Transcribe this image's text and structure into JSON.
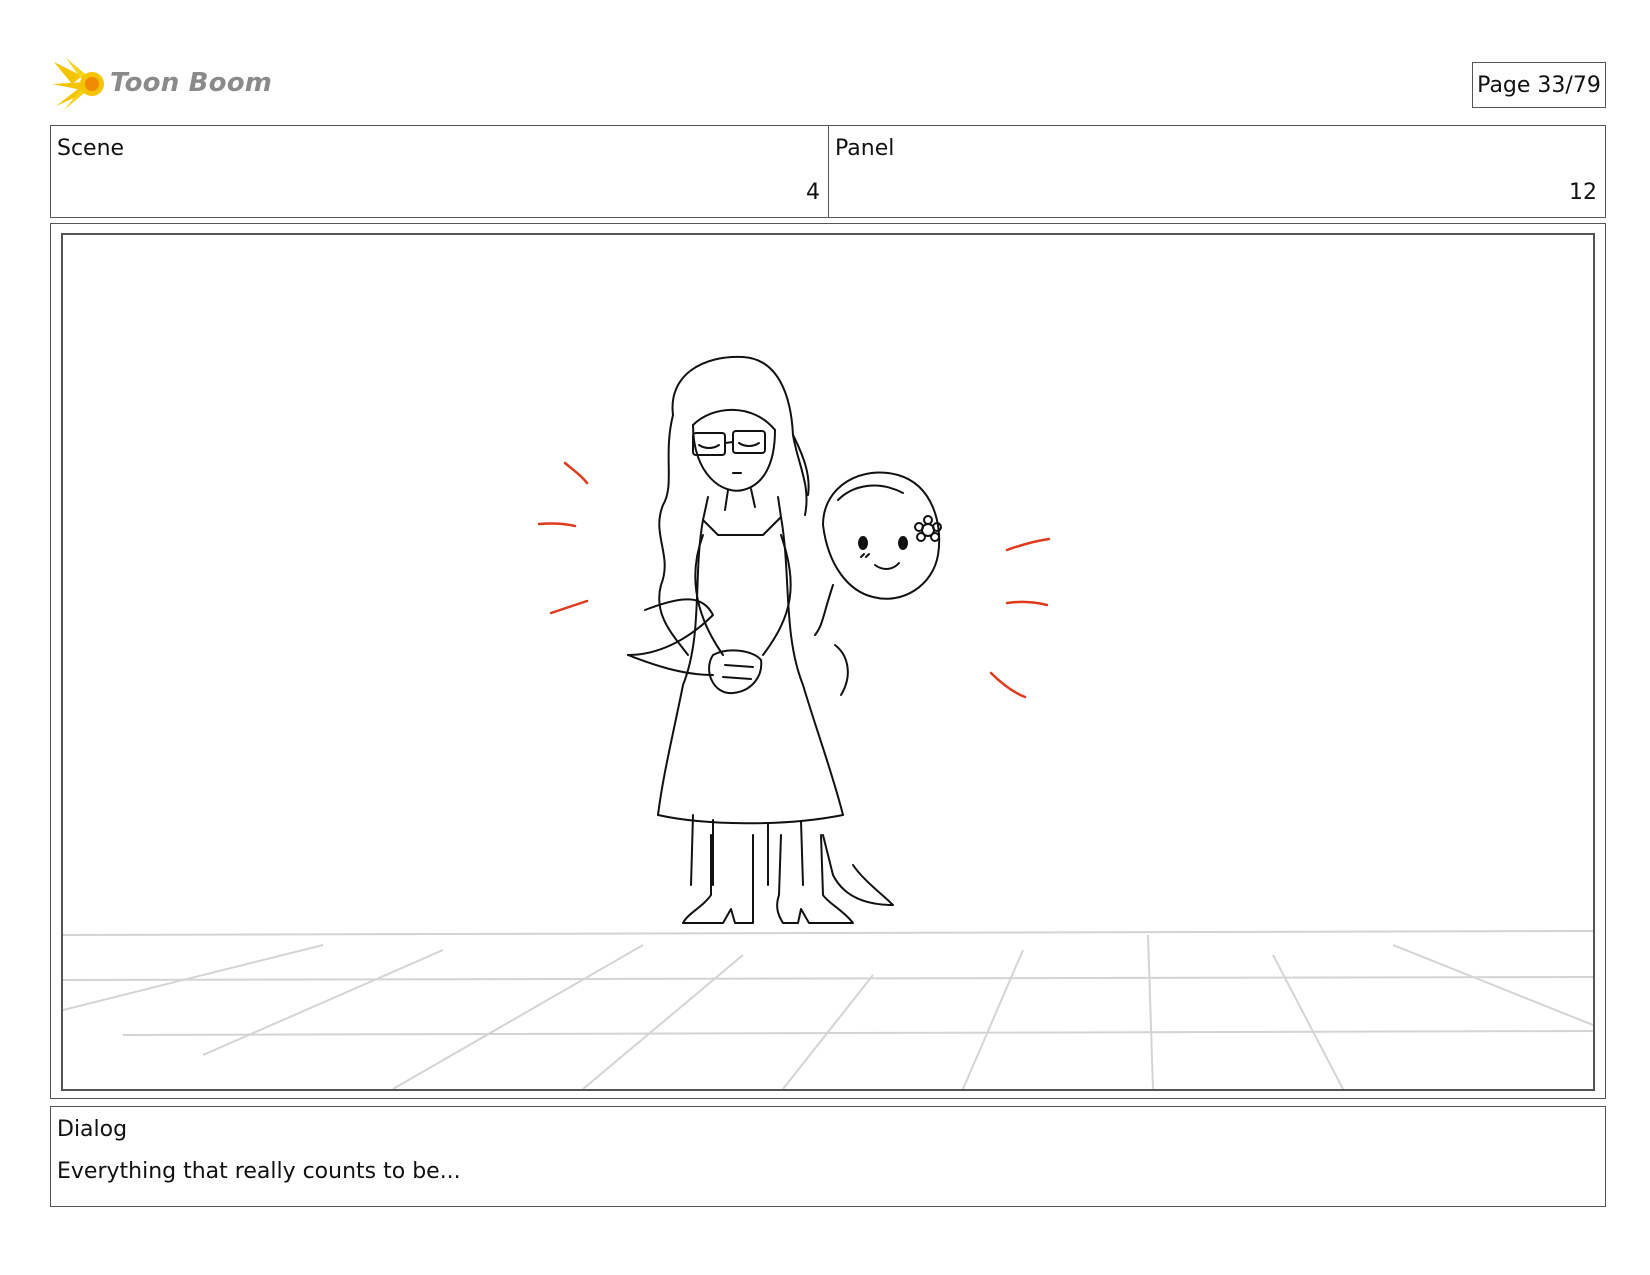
{
  "brand": {
    "name": "Toon Boom"
  },
  "page": {
    "label": "Page 33/79"
  },
  "scene": {
    "label": "Scene",
    "value": "4"
  },
  "panel": {
    "label": "Panel",
    "value": "12"
  },
  "dialog": {
    "label": "Dialog",
    "text": "Everything that really counts to be..."
  },
  "colors": {
    "border": "#555555",
    "logo_yellow": "#f5c400",
    "logo_orange": "#f08a00",
    "sketch_red": "#e03a1e",
    "logo_text": "#8a8a8a"
  }
}
